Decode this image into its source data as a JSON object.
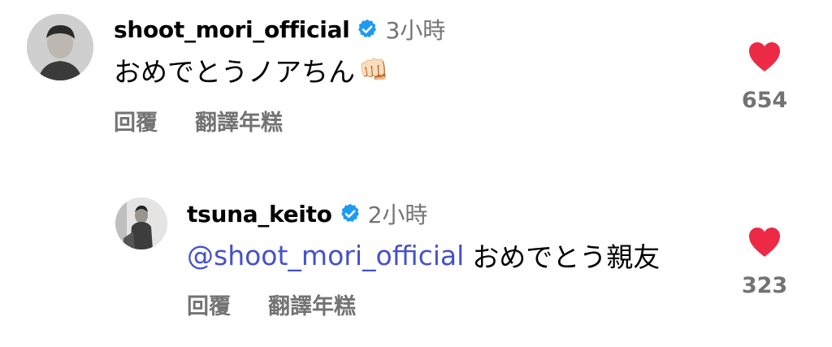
{
  "colors": {
    "heart": "#ed2a45",
    "verified": "#1d9bf0",
    "muted": "#737373",
    "mention": "#4552c9"
  },
  "comments": [
    {
      "username": "shoot_mori_official",
      "time": "3小時",
      "text": "おめでとうノアちん",
      "emoji": "👊🏻",
      "reply_label": "回覆",
      "translate_label": "翻譯年糕",
      "likes": "654"
    },
    {
      "username": "tsuna_keito",
      "time": "2小時",
      "mention": "@shoot_mori_official",
      "text": "おめでとう親友",
      "reply_label": "回覆",
      "translate_label": "翻譯年糕",
      "likes": "323"
    }
  ]
}
